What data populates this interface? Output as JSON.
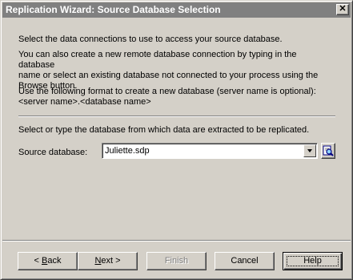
{
  "window": {
    "title": "Replication Wizard: Source Database Selection",
    "close_glyph": "✕"
  },
  "content": {
    "intro": "Select the data connections to use to access your source database.",
    "paragraph2": "You can also create a new remote database connection by typing in the database\nname or select an existing database not connected to your process using the\nBrowse button.",
    "paragraph3": "Use the following format to create a new database (server name is optional):\n<server name>.<database name>",
    "select_prompt": "Select or type the database from which data are extracted to be replicated.",
    "source_label": "Source database:",
    "source_value": "Juliette.sdp",
    "browse_icon": "browse-search-icon"
  },
  "buttons": {
    "back": {
      "prefix": "< ",
      "mnemonic": "B",
      "rest": "ack"
    },
    "next": {
      "mnemonic": "N",
      "rest": "ext >"
    },
    "finish": "Finish",
    "cancel": "Cancel",
    "help": "Help"
  },
  "colors": {
    "face": "#d4d0c8",
    "title_inactive": "#808080",
    "shadow": "#808080",
    "highlight": "#ffffff"
  }
}
